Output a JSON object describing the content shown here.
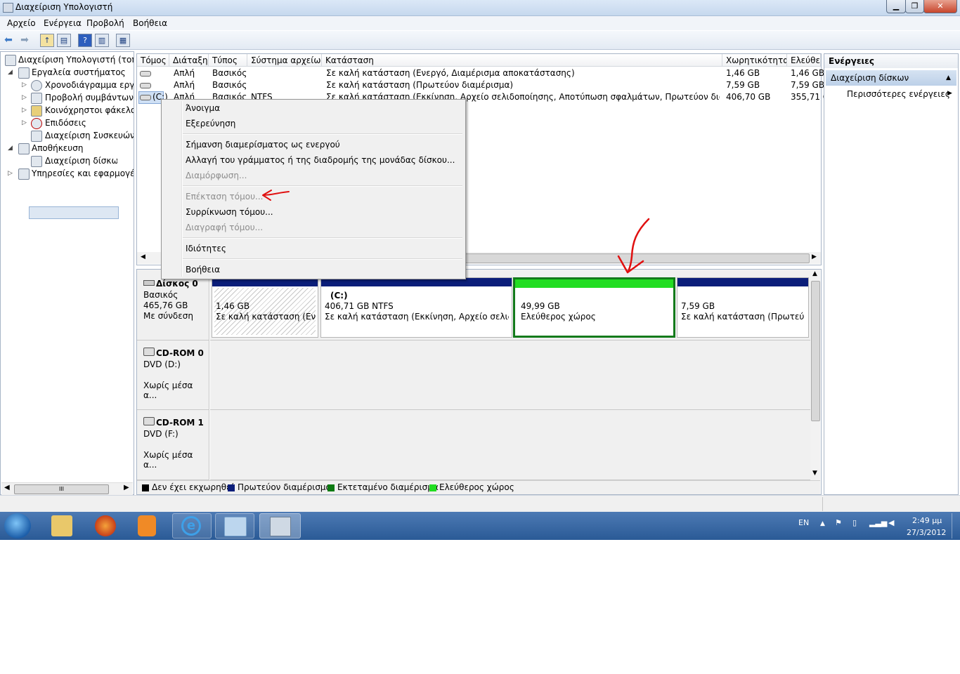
{
  "window": {
    "title": "Διαχείριση Υπολογιστή"
  },
  "menu": [
    "Αρχείο",
    "Ενέργεια",
    "Προβολή",
    "Βοήθεια"
  ],
  "tree": {
    "items": [
      {
        "label": "Διαχείριση Υπολογιστή (τοπικ",
        "icon": "computer-icon"
      },
      {
        "label": "Εργαλεία συστήματος",
        "icon": "tools-icon"
      },
      {
        "label": "Χρονοδιάγραμμα εργασ",
        "icon": "clock-icon"
      },
      {
        "label": "Προβολή συμβάντων",
        "icon": "event-viewer-icon"
      },
      {
        "label": "Κοινόχρηστοι φάκελοι",
        "icon": "shared-folder-icon"
      },
      {
        "label": "Επιδόσεις",
        "icon": "performance-icon"
      },
      {
        "label": "Διαχείριση Συσκευών",
        "icon": "device-manager-icon"
      },
      {
        "label": "Αποθήκευση",
        "icon": "storage-icon"
      },
      {
        "label": "Διαχείριση δίσκων",
        "icon": "disk-management-icon"
      },
      {
        "label": "Υπηρεσίες και εφαρμογές",
        "icon": "services-icon"
      }
    ],
    "scroll_thumb_label": "III"
  },
  "volumes": {
    "columns": [
      "Τόμος",
      "Διάταξη",
      "Τύπος",
      "Σύστημα αρχείων",
      "Κατάσταση",
      "Χωρητικότητα",
      "Ελεύθερ"
    ],
    "rows": [
      {
        "volume": "",
        "layout": "Απλή",
        "type": "Βασικός",
        "fs": "",
        "status": "Σε καλή κατάσταση (Ενεργό, Διαμέρισμα αποκατάστασης)",
        "capacity": "1,46 GB",
        "free": "1,46 GB"
      },
      {
        "volume": "",
        "layout": "Απλή",
        "type": "Βασικός",
        "fs": "",
        "status": "Σε καλή κατάσταση (Πρωτεύον διαμέρισμα)",
        "capacity": "7,59 GB",
        "free": "7,59 GB"
      },
      {
        "volume": "(C:)",
        "layout": "Απλή",
        "type": "Βασικός",
        "fs": "NTFS",
        "status": "Σε καλή κατάσταση (Εκκίνηση, Αρχείο σελιδοποίησης, Αποτύπωση σφαλμάτων, Πρωτεύον διαμέρισμα)",
        "capacity": "406,70 GB",
        "free": "355,71 G"
      }
    ]
  },
  "context_menu": {
    "items": [
      {
        "label": "Άνοιγμα",
        "enabled": true
      },
      {
        "label": "Εξερεύνηση",
        "enabled": true
      },
      {
        "label": "Σήμανση διαμερίσματος ως ενεργού",
        "enabled": true
      },
      {
        "label": "Αλλαγή  του γράμματος ή της διαδρομής της μονάδας δίσκου...",
        "enabled": true
      },
      {
        "label": "Διαμόρφωση...",
        "enabled": false
      },
      {
        "label": "Επέκταση τόμου...",
        "enabled": false
      },
      {
        "label": "Συρρίκνωση τόμου...",
        "enabled": true
      },
      {
        "label": "Διαγραφή τόμου...",
        "enabled": false
      },
      {
        "label": "Ιδιότητες",
        "enabled": true
      },
      {
        "label": "Βοήθεια",
        "enabled": true
      }
    ]
  },
  "disks": [
    {
      "name": "Δίσκος 0",
      "type": "Βασικός",
      "size": "465,76 GB",
      "status": "Με σύνδεση",
      "partitions": [
        {
          "title": "",
          "size": "1,46 GB",
          "status": "Σε καλή κατάσταση (Ενεργ",
          "bar": "#0b1e7a",
          "hatched": true
        },
        {
          "title": "(C:)",
          "size": "406,71 GB NTFS",
          "status": "Σε καλή κατάσταση (Εκκίνηση, Αρχείο σελιδοποι",
          "bar": "#0b1e7a",
          "hatched": false
        },
        {
          "title": "",
          "size": "49,99 GB",
          "status": "Ελεύθερος χώρος",
          "bar": "#22dd22",
          "hatched": false
        },
        {
          "title": "",
          "size": "7,59 GB",
          "status": "Σε καλή κατάσταση (Πρωτεύον δ",
          "bar": "#0b1e7a",
          "hatched": false
        }
      ]
    },
    {
      "name": "CD-ROM 0",
      "type": "DVD (D:)",
      "status": "Χωρίς μέσα α..."
    },
    {
      "name": "CD-ROM 1",
      "type": "DVD (F:)",
      "status": "Χωρίς μέσα α..."
    }
  ],
  "legend": [
    {
      "label": "Δεν έχει εκχωρηθεί",
      "color": "#000000"
    },
    {
      "label": "Πρωτεύον διαμέρισμα",
      "color": "#0b1e7a"
    },
    {
      "label": "Εκτεταμένο διαμέρισμα",
      "color": "#0c7a12"
    },
    {
      "label": "Ελεύθερος χώρος",
      "color": "#22dd22"
    }
  ],
  "actions": {
    "header": "Ενέργειες",
    "section": "Διαχείριση δίσκων",
    "more": "Περισσότερες ενέργειες"
  },
  "taskbar": {
    "language": "EN",
    "time": "2:49 μμ",
    "date": "27/3/2012",
    "apps": [
      "explorer-icon",
      "firefox-icon",
      "media-player-icon",
      "internet-explorer-icon",
      "control-panel-icon",
      "computer-management-icon"
    ]
  },
  "colors": {
    "primary_partition": "#0b1e7a",
    "free_space": "#22dd22",
    "annotation": "#e01010"
  }
}
